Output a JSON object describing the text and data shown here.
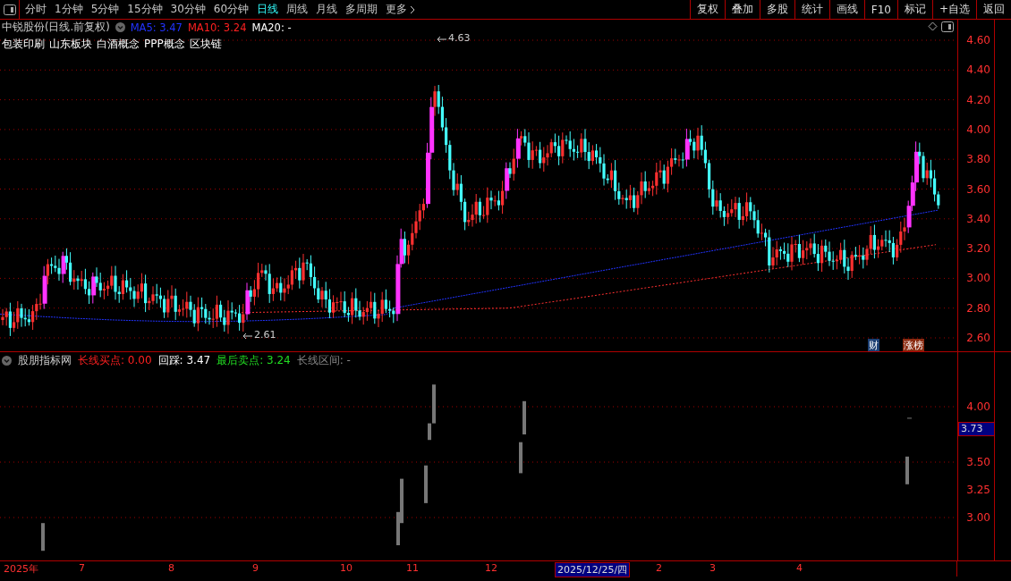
{
  "toolbar": {
    "periods": [
      {
        "label": "分时",
        "selected": false
      },
      {
        "label": "1分钟",
        "selected": false
      },
      {
        "label": "5分钟",
        "selected": false
      },
      {
        "label": "15分钟",
        "selected": false
      },
      {
        "label": "30分钟",
        "selected": false
      },
      {
        "label": "60分钟",
        "selected": false
      },
      {
        "label": "日线",
        "selected": true
      },
      {
        "label": "周线",
        "selected": false
      },
      {
        "label": "月线",
        "selected": false
      },
      {
        "label": "多周期",
        "selected": false
      },
      {
        "label": "更多",
        "selected": false
      }
    ],
    "buttons": [
      "复权",
      "叠加",
      "多股",
      "统计",
      "画线",
      "F10",
      "标记",
      "+自选",
      "返回"
    ]
  },
  "main_chart": {
    "title": "中锐股份(日线.前复权)",
    "ma": [
      {
        "label": "MA5: 3.47",
        "color": "#2233ff"
      },
      {
        "label": "MA10: 3.24",
        "color": "#ff2020"
      },
      {
        "label": "MA20: -",
        "color": "#ffffff"
      }
    ],
    "concepts": [
      "包装印刷",
      "山东板块",
      "白酒概念",
      "PPP概念",
      "区块链"
    ],
    "high_label": "4.63",
    "low_label": "2.61",
    "axis_ticks": [
      "4.60",
      "4.40",
      "4.20",
      "4.00",
      "3.80",
      "3.60",
      "3.40",
      "3.20",
      "3.00",
      "2.80",
      "2.60"
    ],
    "badges": [
      {
        "label": "财",
        "color": "#1c3f73"
      },
      {
        "label": "涨榜",
        "color": "#8a2a10"
      }
    ]
  },
  "indicator": {
    "name": "股朋指标网",
    "values": [
      {
        "label": "长线买点: 0.00",
        "color": "#ff2020"
      },
      {
        "label": "回踩: 3.47",
        "color": "#ffffff"
      },
      {
        "label": "最后卖点: 3.24",
        "color": "#22dd22"
      },
      {
        "label": "长线区间: -",
        "color": "#888888"
      }
    ],
    "axis_ticks": [
      "4.00",
      "3.50",
      "3.25",
      "3.00"
    ],
    "cursor_value": "3.73"
  },
  "date_axis": {
    "labels": [
      {
        "label": "2025年",
        "selected": false
      },
      {
        "label": "7",
        "selected": false
      },
      {
        "label": "8",
        "selected": false
      },
      {
        "label": "9",
        "selected": false
      },
      {
        "label": "10",
        "selected": false
      },
      {
        "label": "11",
        "selected": false
      },
      {
        "label": "12",
        "selected": false
      },
      {
        "label": "2025/12/25/四",
        "selected": true
      },
      {
        "label": "2",
        "selected": false
      },
      {
        "label": "3",
        "selected": false
      },
      {
        "label": "4",
        "selected": false
      }
    ]
  }
}
